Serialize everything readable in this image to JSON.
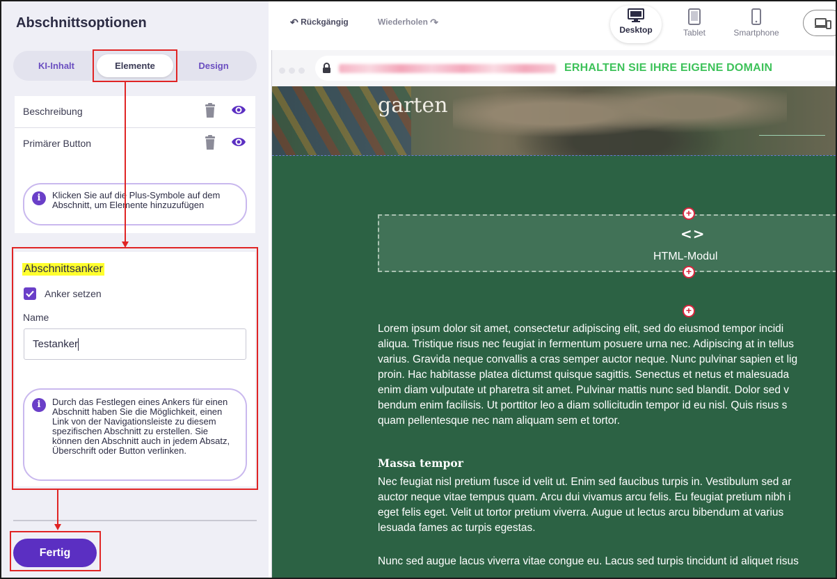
{
  "panel": {
    "title": "Abschnittsoptionen",
    "tabs": [
      "KI-Inhalt",
      "Elemente",
      "Design"
    ],
    "elements": [
      {
        "label": "Beschreibung"
      },
      {
        "label": "Primärer Button"
      }
    ],
    "elements_hint": "Klicken Sie auf die Plus-Symbole auf dem Abschnitt, um Elemente hinzuzufügen",
    "anchor": {
      "title": "Abschnittsanker",
      "checkbox_label": "Anker setzen",
      "checked": true,
      "name_label": "Name",
      "name_value": "Testanker",
      "hint": "Durch das Festlegen eines Ankers für einen Abschnitt haben Sie die Möglichkeit, einen Link von der Navigationsleiste zu diesem spezifischen Abschnitt zu erstellen. Sie können den Abschnitt auch in jedem Absatz, Überschrift oder Button verlinken."
    },
    "done_label": "Fertig"
  },
  "toolbar": {
    "undo": "Rückgängig",
    "redo": "Wiederholen",
    "devices": [
      "Desktop",
      "Tablet",
      "Smartphone"
    ],
    "active_device": "Desktop"
  },
  "browser": {
    "domain_cta": "ERHALTEN SIE IHRE EIGENE DOMAIN",
    "cta_color": "#3ec25a"
  },
  "preview": {
    "hero_text": "garten",
    "module_label": "HTML-Modul",
    "para1": [
      "Lorem ipsum dolor sit amet, consectetur adipiscing elit, sed do eiusmod tempor incidi",
      "aliqua. Tristique risus nec feugiat in fermentum posuere urna nec. Adipiscing at in tellus",
      "varius. Gravida neque convallis a cras semper auctor neque. Nunc pulvinar sapien et lig",
      "proin. Hac habitasse platea dictumst quisque sagittis. Senectus et netus et malesuada",
      "enim diam vulputate ut pharetra sit amet. Pulvinar mattis nunc sed blandit. Dolor sed v",
      "bendum enim facilisis. Ut porttitor leo a diam sollicitudin tempor id eu nisl. Quis risus s",
      "quam pellentesque nec nam aliquam sem et tortor."
    ],
    "subheading": "Massa tempor",
    "para2": [
      "Nec feugiat nisl pretium fusce id velit ut. Enim sed faucibus turpis in. Vestibulum sed ar",
      "auctor neque vitae tempus quam. Arcu dui vivamus arcu felis. Eu feugiat pretium nibh i",
      "eget felis eget. Velit ut tortor pretium viverra. Augue ut lectus arcu bibendum at varius",
      "lesuada fames ac turpis egestas."
    ],
    "para3": [
      "Nunc sed augue lacus viverra vitae congue eu. Lacus sed turpis tincidunt id aliquet risus"
    ]
  },
  "colors": {
    "accent": "#6a3fc8",
    "section_bg": "#2c6244",
    "annotation": "#e02424",
    "highlight": "#ffff2e"
  }
}
